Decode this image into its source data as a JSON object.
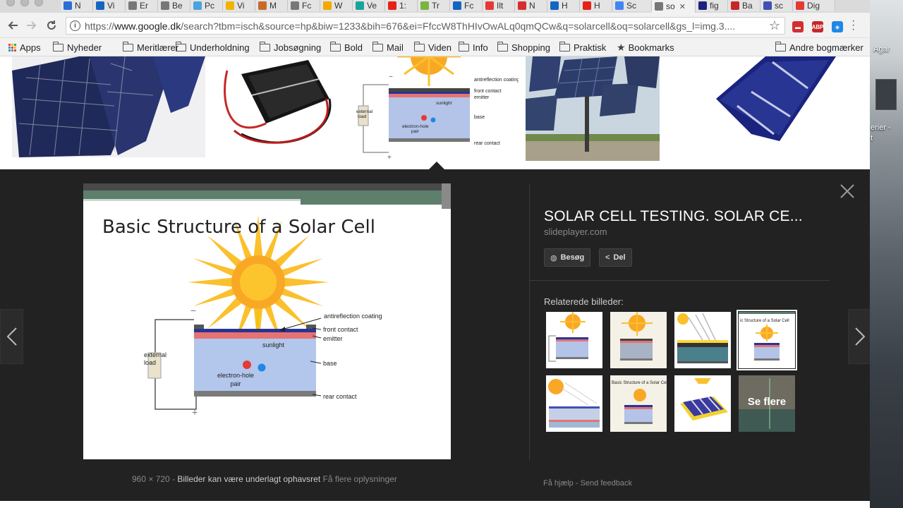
{
  "browser": {
    "tabs": [
      {
        "label": "N",
        "color": "#2a6fd6"
      },
      {
        "label": "Vi",
        "color": "#1565c0"
      },
      {
        "label": "Er",
        "color": "#777777"
      },
      {
        "label": "Be",
        "color": "#777777"
      },
      {
        "label": "Pc",
        "color": "#4aa3df"
      },
      {
        "label": "Vi",
        "color": "#f0b400"
      },
      {
        "label": "M",
        "color": "#c66a2a"
      },
      {
        "label": "Fc",
        "color": "#777777"
      },
      {
        "label": "W",
        "color": "#f2a900"
      },
      {
        "label": "Ve",
        "color": "#1aa39a"
      },
      {
        "label": "1:",
        "color": "#e62117"
      },
      {
        "label": "Tr",
        "color": "#7cb342"
      },
      {
        "label": "Fc",
        "color": "#1565c0"
      },
      {
        "label": "Ilt",
        "color": "#e53935"
      },
      {
        "label": "N",
        "color": "#d32f2f"
      },
      {
        "label": "H",
        "color": "#1565c0"
      },
      {
        "label": "H",
        "color": "#e62117"
      },
      {
        "label": "Sc",
        "color": "#4285f4"
      },
      {
        "label": "so",
        "color": "#777777",
        "active": true
      },
      {
        "label": "fig",
        "color": "#1a237e"
      },
      {
        "label": "Ba",
        "color": "#c62828"
      },
      {
        "label": "sc",
        "color": "#3f51b5"
      },
      {
        "label": "Dig",
        "color": "#e53935"
      }
    ],
    "url_prefix": "https://",
    "url_host": "www.google.dk",
    "url_rest": "/search?tbm=isch&source=hp&biw=1233&bih=676&ei=FfccW8ThHIvOwALq0qmQCw&q=solarcell&oq=solarcell&gs_l=img.3....",
    "extensions": [
      {
        "name": "youtube-ext-icon",
        "color": "#d32f2f",
        "label": "▬"
      },
      {
        "name": "adblock-plus-icon",
        "color": "#c62828",
        "label": "ABP"
      },
      {
        "name": "teal-ext-icon",
        "color": "#1e88e5",
        "label": "◈"
      }
    ]
  },
  "bookmarks": {
    "apps": "Apps",
    "items": [
      "Nyheder",
      "Meritlærer",
      "Underholdning",
      "Jobsøgning",
      "Bold",
      "Mail",
      "Viden",
      "Info",
      "Shopping",
      "Praktisk"
    ],
    "bookmarks_label": "Bookmarks",
    "other": "Andre bogmærker"
  },
  "desktop": {
    "label_top": "Agar",
    "label_mid": "erier -",
    "label_mid2": "t"
  },
  "preview": {
    "slide_title": "Basic Structure of a Solar Cell",
    "diagram_labels": {
      "antireflection": "antireflection coating",
      "front_contact": "front contact",
      "emitter": "emitter",
      "sunlight": "sunlight",
      "base": "base",
      "external_load": "external load",
      "electron_hole": "electron-hole pair",
      "rear_contact": "rear contact",
      "minus": "−",
      "plus": "+"
    },
    "dimensions": "960 × 720",
    "dash": "-",
    "copyright": "Billeder kan være underlagt ophavsret",
    "more_info": "Få flere oplysninger"
  },
  "result": {
    "title": "SOLAR CELL TESTING. SOLAR CE...",
    "source": "slideplayer.com",
    "visit_button": "Besøg",
    "share_button": "Del",
    "related_label": "Relaterede billeder:",
    "see_more": "Se flere",
    "footer_help": "Få hjælp",
    "footer_sep": "-",
    "footer_feedback": "Send feedback"
  }
}
